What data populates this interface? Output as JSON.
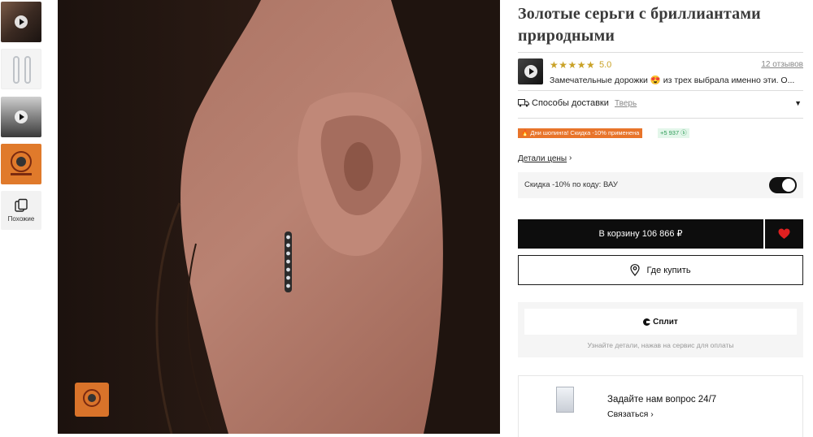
{
  "gallery": {
    "similar_label": "Похожие"
  },
  "product": {
    "title": "Золотые серьги с бриллиантами природными"
  },
  "review": {
    "stars": "★★★★★",
    "rating": "5.0",
    "count": "12 отзывов",
    "text": "Замечательные дорожки 😍 из трех выбрала именно эти. О..."
  },
  "delivery": {
    "label": "Способы доставки",
    "city": "Тверь"
  },
  "promo": {
    "label": "🔥 Дни шопинга! Скидка -10% применена",
    "bonus": "+5 937 ⓑ"
  },
  "price": {
    "details_label": "Детали цены",
    "arrow": "›"
  },
  "discount": {
    "label": "Скидка -10% по коду: ВАУ"
  },
  "actions": {
    "cart_label": "В корзину  106 866 ₽",
    "where_label": "Где купить"
  },
  "split": {
    "label": "Сплит",
    "hint": "Узнайте детали, нажав на сервис для оплаты"
  },
  "ask": {
    "title": "Задайте нам вопрос 24/7",
    "link": "Связаться ›"
  },
  "colors": {
    "accent": "#c9a227",
    "promo": "#e8742a",
    "bonus": "#2e9b57",
    "heart": "#e02020"
  }
}
